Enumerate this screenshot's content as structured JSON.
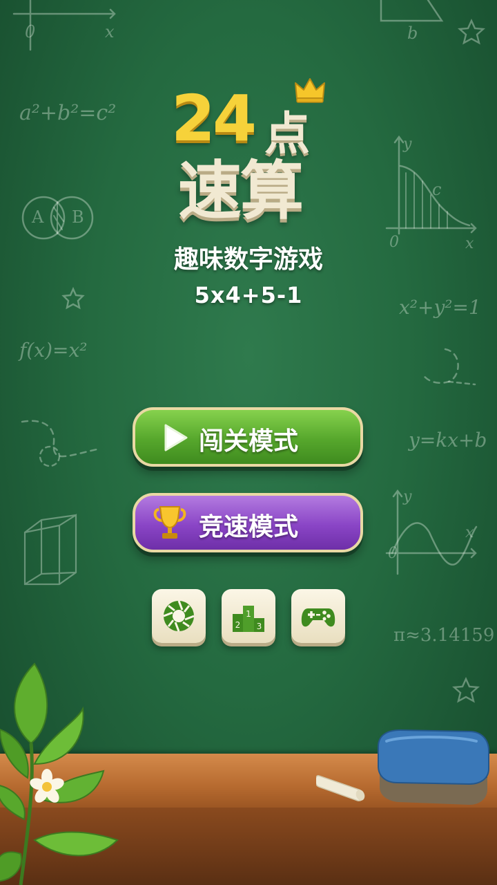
{
  "logo": {
    "number": "24",
    "char": "点",
    "title": "速算"
  },
  "subtitle": "趣味数字游戏",
  "formula": "5x4+5-1",
  "buttons": {
    "level_mode": "闯关模式",
    "speed_mode": "竞速模式"
  },
  "icon_buttons": [
    {
      "icon": "aperture-icon"
    },
    {
      "icon": "podium-icon",
      "ranks": [
        "2",
        "1",
        "3"
      ]
    },
    {
      "icon": "gamepad-icon"
    }
  ],
  "chalk_notes": {
    "pythagoras": "a²+b²=c²",
    "function": "f(x)=x²",
    "circle": "x²+y²=1",
    "line": "y=kx+b",
    "pi": "π≈3.14159",
    "venn_a": "A",
    "venn_b": "B",
    "axis_x_top": "x",
    "axis_o_top": "0",
    "triangle_b": "b",
    "curve_y": "y",
    "curve_c": "c",
    "curve_o": "0",
    "curve_x": "x",
    "sine_y": "y",
    "sine_o": "0",
    "sine_x": "x"
  },
  "colors": {
    "board": "#246a40",
    "green_button": "#56a72c",
    "purple_button": "#8a45c6",
    "logo_yellow": "#f6d23a",
    "logo_cream": "#f1e9d2"
  }
}
